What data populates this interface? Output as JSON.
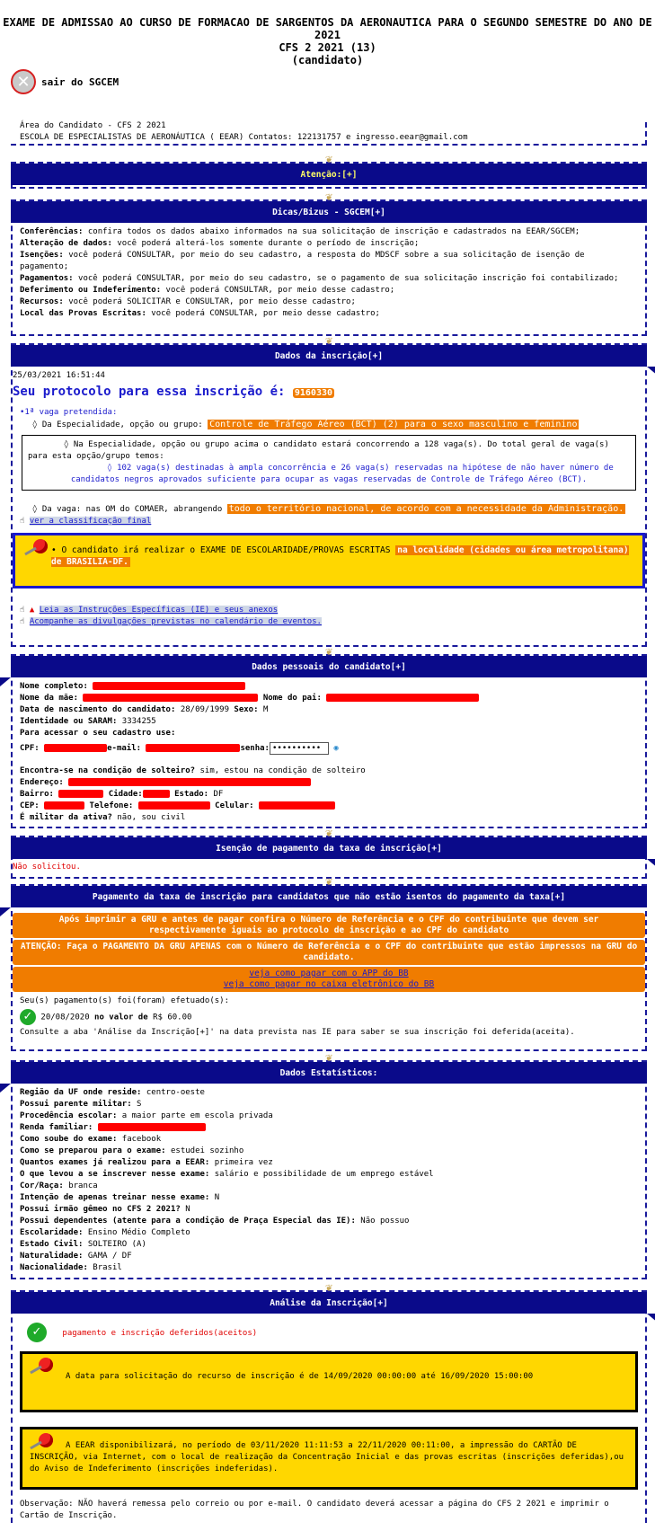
{
  "header": {
    "line1": "EXAME DE ADMISSAO AO CURSO DE FORMACAO DE SARGENTOS DA AERONAUTICA PARA O SEGUNDO SEMESTRE DO ANO DE",
    "line2": "2021",
    "line3": "CFS 2 2021 (13)",
    "line4": "(candidato)"
  },
  "exit_label": "sair do SGCEM",
  "area": {
    "title": "Área do Candidato - CFS 2 2021",
    "contact": "ESCOLA DE ESPECIALISTAS DE AERONÁUTICA ( EEAR) Contatos: 122131757 e ingresso.eear@gmail.com"
  },
  "atencao": {
    "title": "Atenção:[+]"
  },
  "dicas": {
    "title": "Dicas/Bizus - SGCEM[+]",
    "items": [
      {
        "label": "Conferências:",
        "text": " confira todos os dados abaixo informados na sua solicitação de inscrição e cadastrados na EEAR/SGCEM;"
      },
      {
        "label": "Alteração de dados:",
        "text": " você poderá alterá-los somente durante o período de inscrição;"
      },
      {
        "label": "Isenções:",
        "text": " você poderá CONSULTAR, por meio do seu cadastro, a resposta do MDSCF sobre a sua solicitação de isenção de pagamento;"
      },
      {
        "label": "Pagamentos:",
        "text": " você poderá CONSULTAR, por meio do seu cadastro, se o pagamento de sua solicitação inscrição foi contabilizado;"
      },
      {
        "label": "Deferimento ou Indeferimento:",
        "text": " você poderá CONSULTAR, por meio desse cadastro;"
      },
      {
        "label": "Recursos:",
        "text": " você poderá SOLICITAR e CONSULTAR, por meio desse cadastro;"
      },
      {
        "label": "Local das Provas Escritas:",
        "text": " você poderá CONSULTAR, por meio desse cadastro;"
      }
    ]
  },
  "inscricao": {
    "title": "Dados da inscrição[+]",
    "timestamp": "25/03/2021 16:51:44",
    "protocol_label": "Seu protocolo para essa inscrição é:",
    "protocol": "9160330",
    "vaga_title": "•1ª vaga pretendida:",
    "especialidade_label": "◊  Da Especialidade, opção ou grupo:",
    "especialidade": "Controle de Tráfego Aéreo (BCT) (2) para o sexo masculino e feminino",
    "box_line1": "◊  Na Especialidade, opção ou grupo acima o candidato estará concorrendo a 128  vaga(s). Do total geral de vaga(s) para esta opção/grupo temos:",
    "box_line2": "◊   102  vaga(s) destinadas à ampla concorrência e 26  vaga(s) reservadas na hipótese de não haver número de candidatos negros aprovados suficiente para ocupar as vagas reservadas de Controle de Tráfego Aéreo (BCT).",
    "da_vaga_label": "◊  Da vaga: nas OM do COMAER, abrangendo",
    "da_vaga": "todo o território nacional, de acordo com a necessidade da Administração.",
    "classificacao_link": "ver a classificação final",
    "exam_text": "• O candidato irá realizar o EXAME DE ESCOLARIDADE/PROVAS ESCRITAS",
    "exam_local": "na localidade (cidades ou área metropolitana) de BRASILIA-DF.",
    "link_ie": "Leia as Instruções Específicas (IE) e seus anexos",
    "link_calendario": "Acompanhe as divulgações previstas no calendário de eventos."
  },
  "pessoais": {
    "title": "Dados pessoais do candidato[+]",
    "nome_label": "Nome completo:",
    "mae_label": "Nome da mãe:",
    "pai_label": "Nome do pai:",
    "nasc_label": "Data de nascimento do candidato:",
    "nasc": "28/09/1999",
    "sexo_label": "Sexo:",
    "sexo": "M",
    "ident_label": "Identidade ou SARAM:",
    "ident": "3334255",
    "acesso_label": "Para acessar o seu cadastro use:",
    "cpf_label": "CPF:",
    "email_label": "e-mail:",
    "senha_label": "senha:",
    "senha_value": "••••••••••",
    "solteiro_label": "Encontra-se na condição de solteiro?",
    "solteiro": "sim, estou na condição de solteiro",
    "endereco_label": "Endereço:",
    "bairro_label": "Bairro:",
    "cidade_label": "Cidade:",
    "estado_label": "Estado:",
    "estado": "DF",
    "cep_label": "CEP:",
    "telefone_label": "Telefone:",
    "celular_label": "Celular:",
    "militar_label": "É militar da ativa?",
    "militar": "não, sou civil"
  },
  "isencao": {
    "title": "Isenção de pagamento da taxa de inscrição[+]",
    "status": "Não solicitou."
  },
  "pagamento": {
    "title": "Pagamento da taxa de inscrição para candidatos que não estão isentos do pagamento da taxa[+]",
    "banner1": "Após imprimir a GRU e antes de pagar confira o Número de Referência e o CPF do contribuinte que devem ser respectivamente iguais ao protocolo de inscrição e ao CPF do candidato",
    "banner2": "ATENÇÃO: Faça o PAGAMENTO DA GRU APENAS com o Número de Referência e o CPF do contribuinte que estão impressos na GRU do candidato.",
    "link_app": "veja como pagar com o APP do BB",
    "link_caixa": "veja como pagar no caixa eletrônico do BB",
    "efetuado_label": "Seu(s) pagamento(s) foi(foram) efetuado(s):",
    "data": "20/08/2020",
    "valor_label": "no valor de",
    "valor": "R$ 60.00",
    "consulte": "Consulte a aba 'Análise da Inscrição[+]' na data prevista nas IE para saber se sua inscrição foi deferida(aceita)."
  },
  "estatisticos": {
    "title": "Dados Estatísticos:",
    "rows": [
      {
        "label": "Região da UF onde reside:",
        "value": " centro-oeste"
      },
      {
        "label": "Possui parente militar:",
        "value": " S"
      },
      {
        "label": "Procedência escolar:",
        "value": " a maior parte em escola privada"
      },
      {
        "label": "Renda familiar:",
        "value": " "
      },
      {
        "label": "Como soube do exame:",
        "value": " facebook"
      },
      {
        "label": "Como se preparou para o exame:",
        "value": " estudei sozinho"
      },
      {
        "label": "Quantos exames já realizou para a EEAR:",
        "value": " primeira vez"
      },
      {
        "label": "O que levou a se inscrever nesse exame:",
        "value": " salário e possibilidade de um emprego estável"
      },
      {
        "label": "Cor/Raça:",
        "value": " branca"
      },
      {
        "label": "Intenção de apenas treinar nesse exame:",
        "value": " N"
      },
      {
        "label": "Possui irmão gêmeo no CFS 2 2021?",
        "value": " N"
      },
      {
        "label": "Possui dependentes (atente para a condição de Praça Especial das IE):",
        "value": " Não possuo"
      },
      {
        "label": "Escolaridade:",
        "value": " Ensino Médio Completo"
      },
      {
        "label": "Estado Civil:",
        "value": " SOLTEIRO (A)"
      },
      {
        "label": "Naturalidade:",
        "value": " GAMA / DF"
      },
      {
        "label": "Nacionalidade:",
        "value": " Brasil"
      }
    ]
  },
  "analise": {
    "title": "Análise da Inscrição[+]",
    "status": "pagamento e inscrição deferidos(aceitos)",
    "recurso": "A data para solicitação do recurso de inscrição é de 14/09/2020 00:00:00 até 16/09/2020 15:00:00",
    "cartao": "A EEAR disponibilizará, no período de 03/11/2020 11:11:53 a 22/11/2020 00:11:00, a impressão do CARTÃO DE INSCRIÇÃO, via Internet, com o local de realização da Concentração Inicial e das provas escritas (inscrições deferidas),ou do Aviso de Indeferimento (inscrições indeferidas).",
    "observacao": "Observação: NÃO haverá remessa pelo correio ou por e-mail. O candidato deverá acessar a página do CFS 2 2021 e imprimir o Cartão de Inscrição."
  },
  "icons": {
    "exit": "close-circle-icon",
    "check": "check-circle-icon",
    "pin": "pushpin-icon",
    "hand": "pointing-hand-icon",
    "eye": "eye-icon"
  }
}
